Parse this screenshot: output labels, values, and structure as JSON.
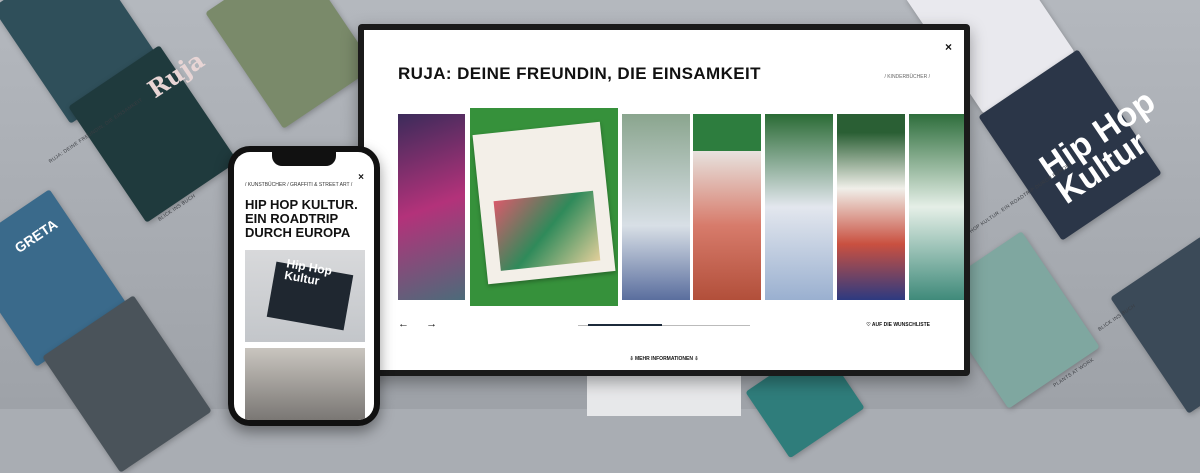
{
  "background": {
    "tiles": [
      {
        "title": "Ruja"
      },
      {
        "title": "GRETA"
      },
      {
        "title": "Hip Hop Kultur"
      }
    ],
    "captions": [
      "RUJA: DEINE FREUNDIN, DIE EINSAMKEIT",
      "BLICK INS BUCH",
      "HIP HOP KULTUR. EIN ROADTRIP DURCH EUROPA",
      "BLICK INS BUCH",
      "PLANTS AT WORK"
    ]
  },
  "desktop": {
    "title": "RUJA: DEINE FREUNDIN, DIE EINSAMKEIT",
    "breadcrumb": "/ KINDERBÜCHER /",
    "close_icon": "×",
    "prev_icon": "←",
    "next_icon": "→",
    "progress": 0.43,
    "wishlist": "♡ AUF DIE WUNSCHLISTE",
    "more_info": "⇩  MEHR INFORMATIONEN  ⇩"
  },
  "mobile": {
    "breadcrumb": "/ KUNSTBÜCHER / GRAFFITI & STREET ART /",
    "close_icon": "×",
    "title": "HIP HOP KULTUR. EIN ROADTRIP DURCH EUROPA",
    "book_title": "Hip Hop Kultur"
  },
  "colors": {
    "accent_dark": "#1c2a3a",
    "gallery_green": "#36913b"
  }
}
